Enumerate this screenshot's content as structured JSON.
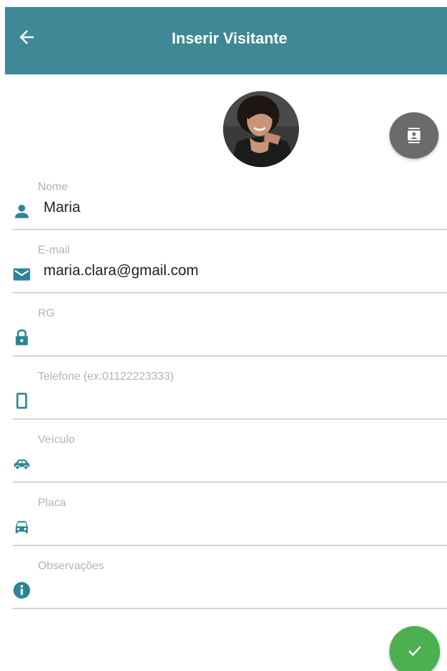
{
  "header": {
    "title": "Inserir Visitante",
    "back_icon": "arrow-back-icon",
    "background_color": "#3f8896"
  },
  "photo": {
    "icon": "avatar",
    "contacts_button_icon": "contacts-icon"
  },
  "form": {
    "fields": [
      {
        "label": "Nome",
        "value": "Maria",
        "icon": "person-icon"
      },
      {
        "label": "E-mail",
        "value": "maria.clara@gmail.com",
        "icon": "email-icon"
      },
      {
        "label": "RG",
        "value": "",
        "icon": "lock-icon"
      },
      {
        "label": "Telefone (ex:01122223333)",
        "value": "",
        "icon": "phone-icon"
      },
      {
        "label": "Veículo",
        "value": "",
        "icon": "car-side-icon"
      },
      {
        "label": "Placa",
        "value": "",
        "icon": "car-front-icon"
      },
      {
        "label": "Observações",
        "value": "",
        "icon": "info-icon"
      }
    ],
    "icon_color": "#2b8596"
  },
  "actions": {
    "confirm_icon": "check-icon",
    "confirm_color": "#4caf50"
  }
}
